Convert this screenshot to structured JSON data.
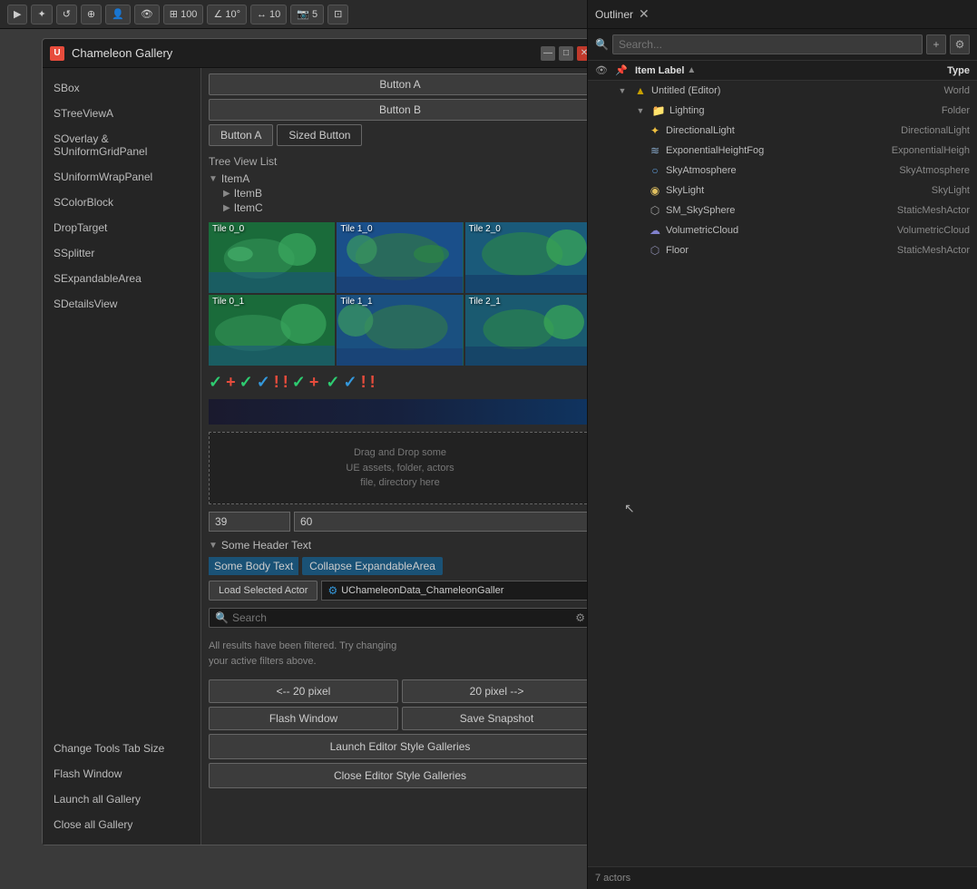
{
  "toolbar": {
    "buttons": [
      {
        "label": "▶",
        "name": "select-tool"
      },
      {
        "label": "✦",
        "name": "transform-tool"
      },
      {
        "label": "↺",
        "name": "rotate-tool"
      },
      {
        "label": "⊕",
        "name": "scale-tool"
      },
      {
        "label": "👤",
        "name": "person-tool"
      },
      {
        "label": "👁",
        "name": "visibility-tool"
      },
      {
        "label": "⊞ 100",
        "name": "grid-btn"
      },
      {
        "label": "∠ 10°",
        "name": "angle-btn"
      },
      {
        "label": "↔ 10",
        "name": "distance-btn"
      },
      {
        "label": "📷 5",
        "name": "camera-btn"
      },
      {
        "label": "⊡",
        "name": "layout-btn"
      }
    ]
  },
  "gallery_window": {
    "title": "Chameleon Gallery",
    "icon": "U",
    "sidebar_items": [
      {
        "label": "SBox",
        "name": "sbox"
      },
      {
        "label": "STreeViewA",
        "name": "streeviewa"
      },
      {
        "label": "SOverlay & SUniformGridPanel",
        "name": "soverlay"
      },
      {
        "label": "SUniformWrapPanel",
        "name": "suniformwrappanel"
      },
      {
        "label": "SColorBlock",
        "name": "scolorblock"
      },
      {
        "label": "DropTarget",
        "name": "droptarget"
      },
      {
        "label": "SSplitter",
        "name": "ssplitter"
      },
      {
        "label": "SExpandableArea",
        "name": "sexpandablearea"
      },
      {
        "label": "SDetailsView",
        "name": "sdetailsview"
      },
      {
        "label": "Change Tools Tab Size",
        "name": "change-tools"
      },
      {
        "label": "Flash Window",
        "name": "flash-window"
      },
      {
        "label": "Launch all Gallery",
        "name": "launch-all-gallery"
      },
      {
        "label": "Close all Gallery",
        "name": "close-all-gallery"
      }
    ],
    "buttons": {
      "button_a_1": "Button A",
      "button_b": "Button B",
      "button_a_2": "Button A",
      "sized_button": "Sized Button"
    },
    "tree": {
      "label": "Tree View List",
      "items": [
        {
          "label": "ItemA",
          "level": 0,
          "expanded": true
        },
        {
          "label": "ItemB",
          "level": 1
        },
        {
          "label": "ItemC",
          "level": 1
        }
      ]
    },
    "tiles": [
      {
        "label": "Tile 0_0",
        "row": 0,
        "col": 0
      },
      {
        "label": "Tile 1_0",
        "row": 0,
        "col": 1
      },
      {
        "label": "Tile 2_0",
        "row": 0,
        "col": 2
      },
      {
        "label": "Tile 0_1",
        "row": 1,
        "col": 0
      },
      {
        "label": "Tile 1_1",
        "row": 1,
        "col": 1
      },
      {
        "label": "Tile 2_1",
        "row": 1,
        "col": 2
      }
    ],
    "drop_target_text": "Drag and Drop some\nUE assets, folder, actors\nfile, directory here",
    "splitter": {
      "left_value": "39",
      "right_value": "60"
    },
    "expandable": {
      "header": "Some Header Text",
      "body_text": "Some Body Text",
      "collapse_btn": "Collapse ExpandableArea"
    },
    "details": {
      "load_btn": "Load Selected Actor",
      "asset_path": "UChameleonData_ChameleonGaller"
    },
    "search": {
      "placeholder": "Search",
      "filter_msg": "All results have been filtered. Try changing\nyour active filters above."
    },
    "bottom": {
      "prev_pixel": "<-- 20 pixel",
      "next_pixel": "20 pixel -->",
      "flash_window": "Flash Window",
      "save_snapshot": "Save Snapshot",
      "launch_editor": "Launch Editor Style Galleries",
      "close_editor": "Close Editor Style Galleries"
    }
  },
  "outliner": {
    "title": "Outliner",
    "search_placeholder": "Search...",
    "col_label": "Item Label",
    "col_type": "Type",
    "rows": [
      {
        "label": "Untitled (Editor)",
        "type": "World",
        "level": 0,
        "icon": "▲",
        "icon_color": "#c8a000",
        "expanded": true
      },
      {
        "label": "Lighting",
        "type": "Folder",
        "level": 1,
        "icon": "📁",
        "icon_color": "#c8a000",
        "expanded": true
      },
      {
        "label": "DirectionalLight",
        "type": "DirectionalLight",
        "level": 2,
        "icon": "✦",
        "icon_color": "#f0c040"
      },
      {
        "label": "ExponentialHeightFog",
        "type": "ExponentialHeigh",
        "level": 2,
        "icon": "≋",
        "icon_color": "#88aacc"
      },
      {
        "label": "SkyAtmosphere",
        "type": "SkyAtmosphere",
        "level": 2,
        "icon": "○",
        "icon_color": "#60a0e0"
      },
      {
        "label": "SkyLight",
        "type": "SkyLight",
        "level": 2,
        "icon": "◉",
        "icon_color": "#e0c060"
      },
      {
        "label": "SM_SkySphere",
        "type": "StaticMeshActor",
        "level": 2,
        "icon": "⬡",
        "icon_color": "#a0a0a0"
      },
      {
        "label": "VolumetricCloud",
        "type": "VolumetricCloud",
        "level": 2,
        "icon": "☁",
        "icon_color": "#8080cc"
      },
      {
        "label": "Floor",
        "type": "StaticMeshActor",
        "level": 2,
        "icon": "⬡",
        "icon_color": "#8888aa"
      }
    ],
    "status": "7 actors"
  }
}
